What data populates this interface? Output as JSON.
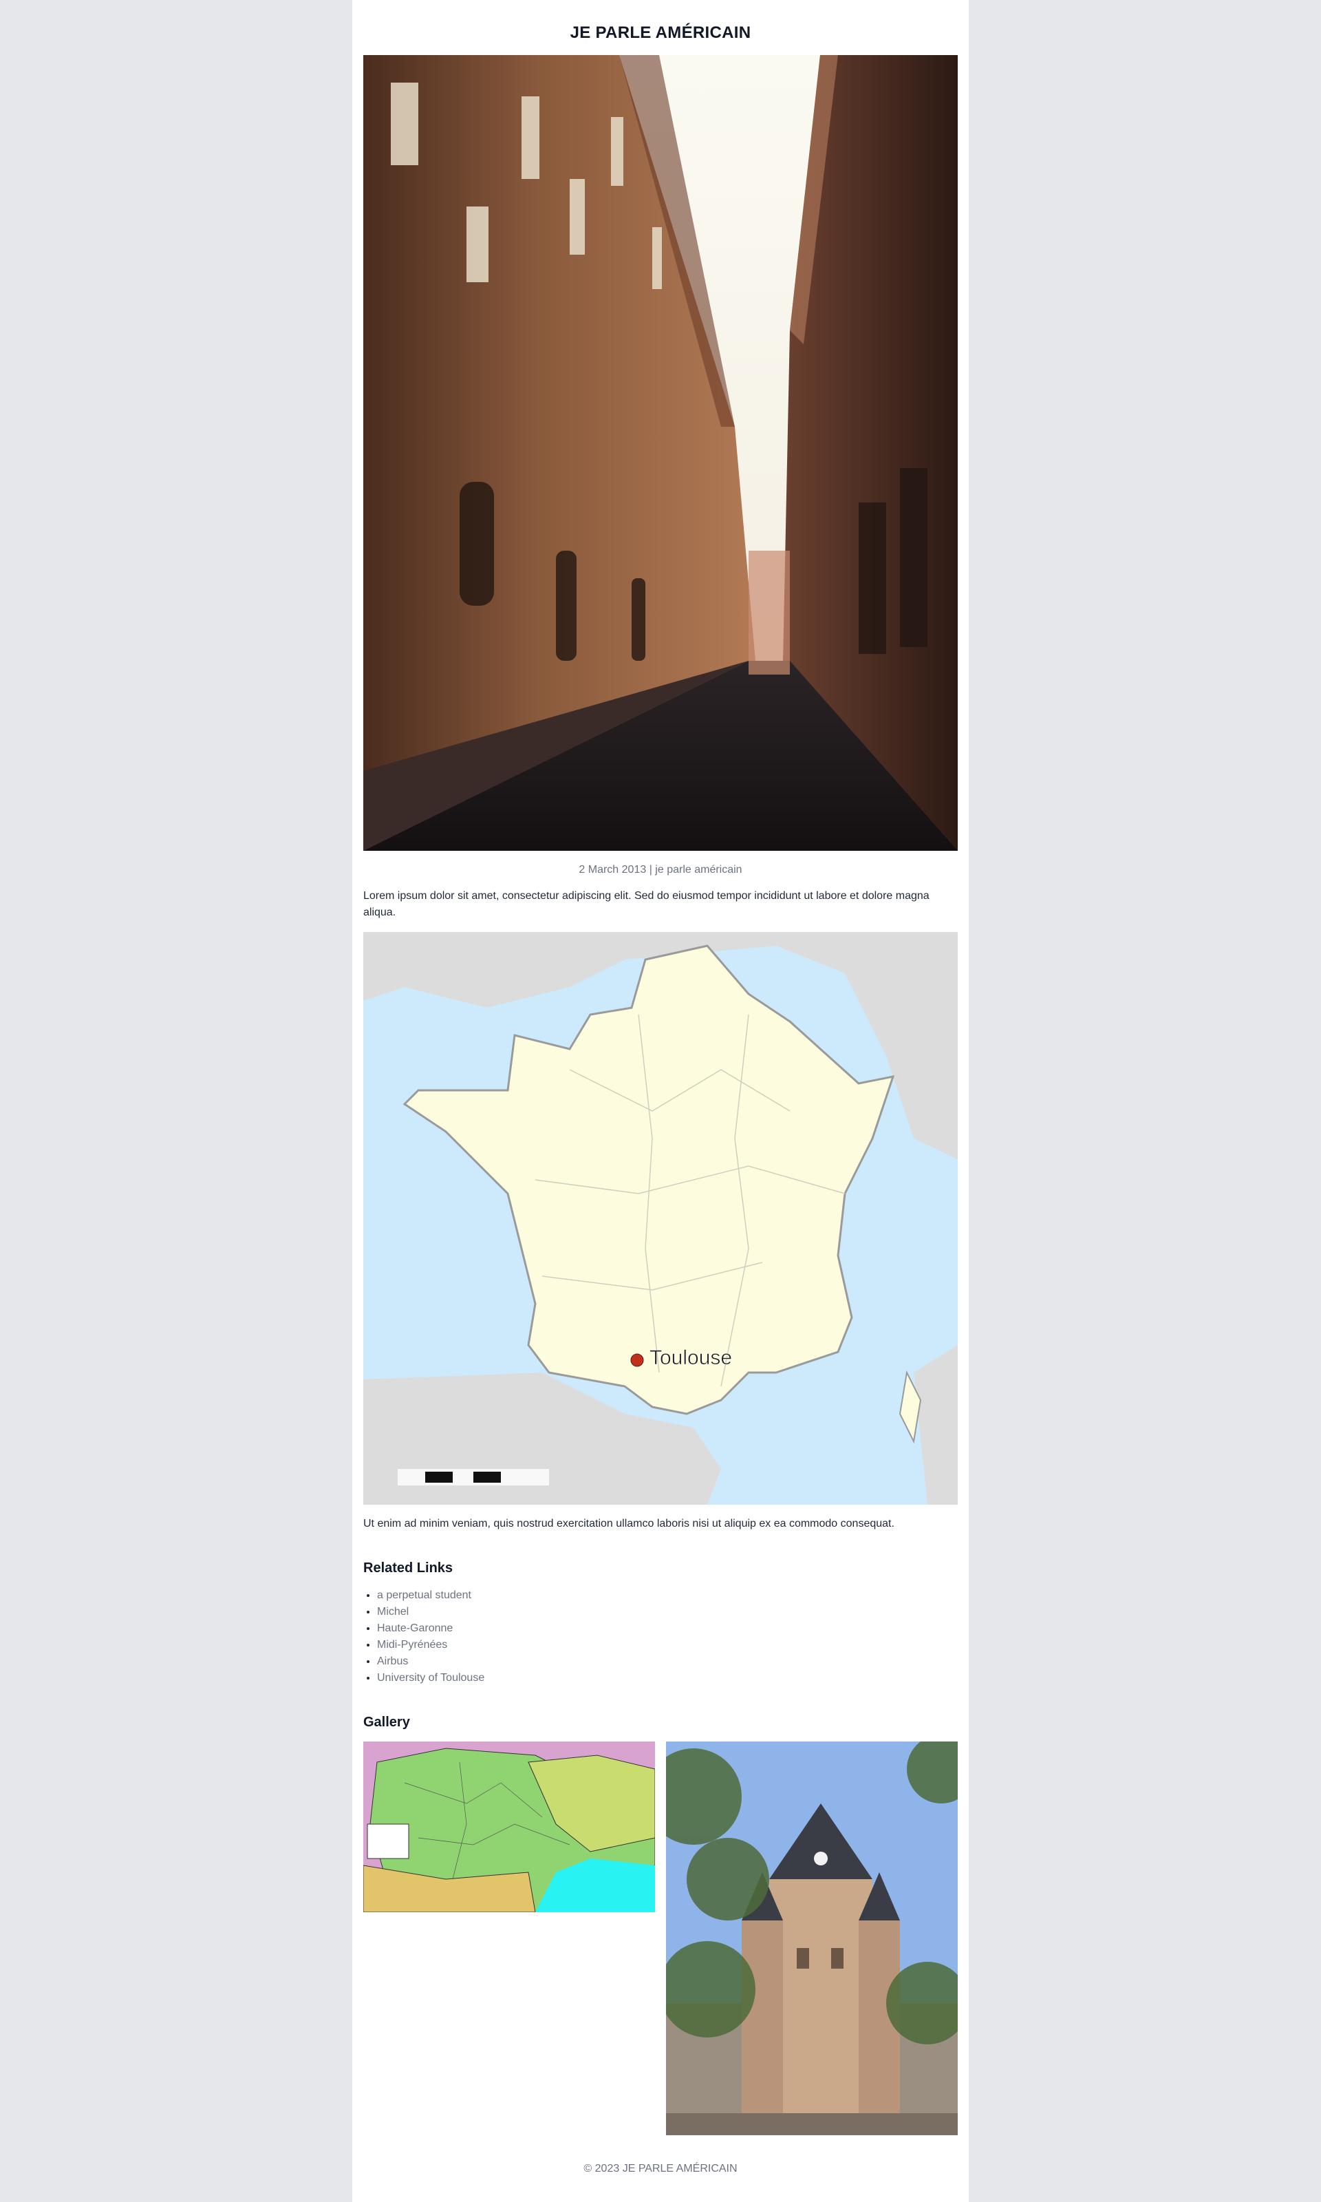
{
  "site": {
    "title": "JE PARLE AMÉRICAIN"
  },
  "post": {
    "meta": "2 March 2013 | je parle américain",
    "intro": "Lorem ipsum dolor sit amet, consectetur adipiscing elit. Sed do eiusmod tempor incididunt ut labore et dolore magna aliqua.",
    "body": "Ut enim ad minim veniam, quis nostrud exercitation ullamco laboris nisi ut aliquip ex ea commodo consequat."
  },
  "map": {
    "label": "Toulouse"
  },
  "related": {
    "heading": "Related Links",
    "items": [
      "a perpetual student",
      "Michel",
      "Haute-Garonne",
      "Midi-Pyrénées",
      "Airbus",
      "University of Toulouse"
    ]
  },
  "gallery": {
    "heading": "Gallery"
  },
  "footer": {
    "text": "© 2023 JE PARLE AMÉRICAIN"
  }
}
